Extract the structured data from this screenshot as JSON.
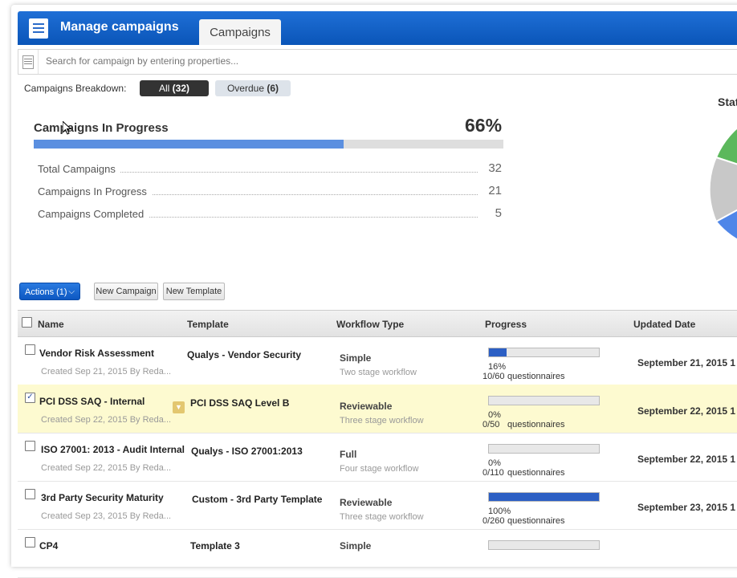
{
  "header": {
    "title": "Manage campaigns",
    "tab": "Campaigns"
  },
  "search": {
    "placeholder": "Search for campaign by entering properties..."
  },
  "breakdown": {
    "label": "Campaigns Breakdown:",
    "all_label": "All",
    "all_count": "(32)",
    "overdue_label": "Overdue",
    "overdue_count": "(6)"
  },
  "status_chart": {
    "title": "Stat",
    "colors": {
      "green": "#5cb85c",
      "grey": "#c8c8c8",
      "blue": "#4f86e8"
    }
  },
  "progress": {
    "title": "Campaigns In Progress",
    "percent": "66%",
    "fraction": 0.66,
    "bar_color": "#5b8fe0",
    "stats": [
      {
        "label": "Total Campaigns",
        "value": "32"
      },
      {
        "label": "Campaigns In Progress",
        "value": "21"
      },
      {
        "label": "Campaigns Completed",
        "value": "5"
      }
    ]
  },
  "toolbar": {
    "actions": "Actions (1)",
    "new_campaign": "New Campaign",
    "new_template": "New Template"
  },
  "table": {
    "columns": [
      "Name",
      "Template",
      "Workflow Type",
      "Progress",
      "Updated Date"
    ],
    "rows": [
      {
        "name": "Vendor Risk Assessment",
        "created": "Created Sep 21, 2015 By Reda...",
        "template": "Qualys - Vendor Security",
        "workflow": "Simple",
        "workflow_sub": "Two stage workflow",
        "progress": 0.16,
        "percent": "16%",
        "count": "10/60",
        "q": "questionnaires",
        "date": "September 21, 2015 1",
        "checked": false
      },
      {
        "name": "PCI DSS SAQ - Internal",
        "created": "Created Sep 22, 2015 By Reda...",
        "template": "PCI DSS SAQ Level B",
        "workflow": "Reviewable",
        "workflow_sub": "Three stage workflow",
        "progress": 0,
        "percent": "0%",
        "count": "0/50",
        "q": "questionnaires",
        "date": "September 22, 2015 1",
        "checked": true
      },
      {
        "name": "ISO 27001: 2013 - Audit Internal",
        "created": "Created Sep 22, 2015 By Reda...",
        "template": "Qualys - ISO 27001:2013",
        "workflow": "Full",
        "workflow_sub": "Four stage workflow",
        "progress": 0,
        "percent": "0%",
        "count": "0/110",
        "q": "questionnaires",
        "date": "September 22, 2015 1",
        "checked": false
      },
      {
        "name": "3rd Party Security Maturity",
        "created": "Created Sep 23, 2015 By Reda...",
        "template": "Custom - 3rd Party Template",
        "workflow": "Reviewable",
        "workflow_sub": "Three stage workflow",
        "progress": 1.0,
        "percent": "100%",
        "count": "0/260",
        "q": "questionnaires",
        "date": "September 23, 2015 1",
        "checked": false
      },
      {
        "name": "CP4",
        "created": "",
        "template": "Template 3",
        "workflow": "Simple",
        "workflow_sub": "",
        "progress": 0,
        "percent": "",
        "count": "",
        "q": "",
        "date": "",
        "checked": false
      }
    ]
  }
}
